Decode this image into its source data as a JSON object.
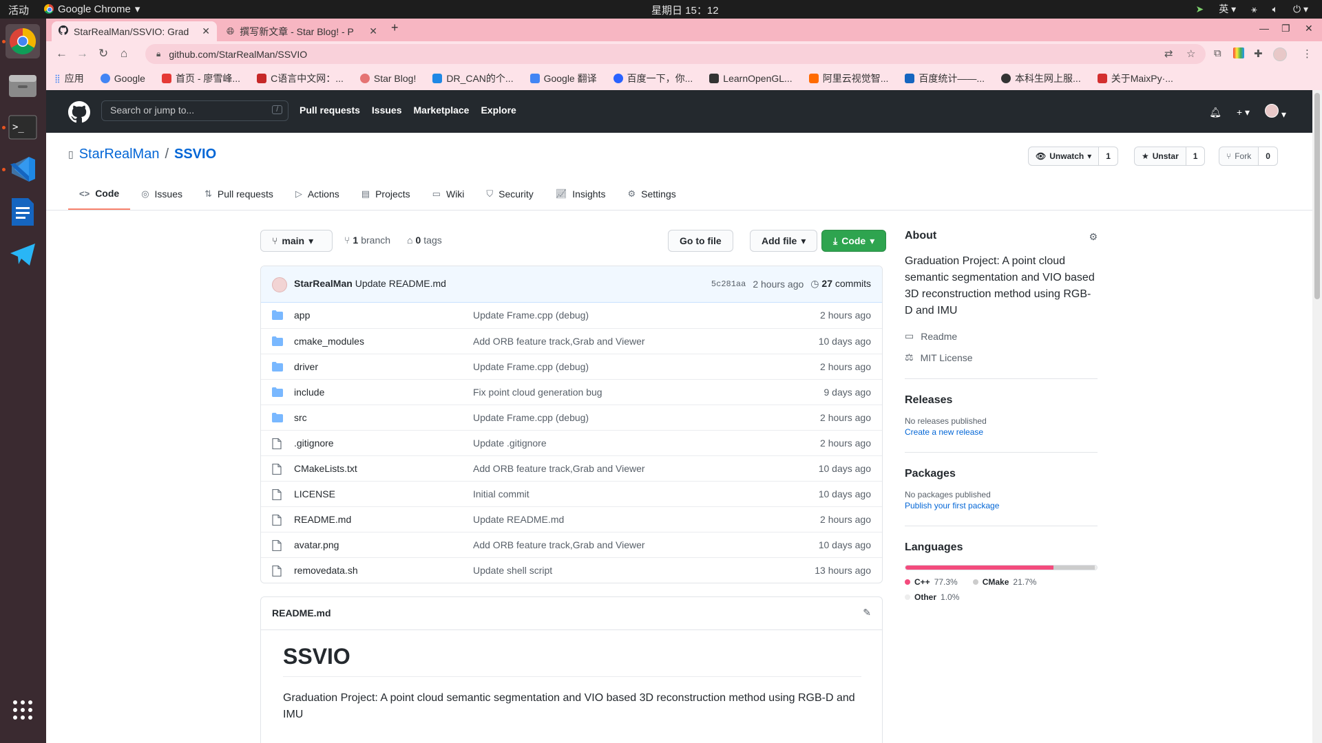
{
  "os": {
    "activities": "活动",
    "app_name": "Google Chrome",
    "clock": "星期日 15：12",
    "ime": "英"
  },
  "browser": {
    "tabs": [
      {
        "title": "StarRealMan/SSVIO: Grad",
        "active": true
      },
      {
        "title": "撰写新文章 - Star Blog! - P",
        "active": false
      }
    ],
    "url": "github.com/StarRealMan/SSVIO",
    "bookmarks": [
      {
        "label": "应用",
        "color": "#4285f4"
      },
      {
        "label": "Google",
        "color": "#4285f4"
      },
      {
        "label": "首页 - 廖雪峰...",
        "color": "#e53935"
      },
      {
        "label": "C语言中文网：...",
        "color": "#c62828"
      },
      {
        "label": "Star Blog!",
        "color": "#e57373"
      },
      {
        "label": "DR_CAN的个...",
        "color": "#1e88e5"
      },
      {
        "label": "Google 翻译",
        "color": "#4285f4"
      },
      {
        "label": "百度一下，你...",
        "color": "#2962ff"
      },
      {
        "label": "LearnOpenGL...",
        "color": "#333333"
      },
      {
        "label": "阿里云视觉智...",
        "color": "#ff6a00"
      },
      {
        "label": "百度统计——...",
        "color": "#1565c0"
      },
      {
        "label": "本科生网上服...",
        "color": "#333333"
      },
      {
        "label": "关于MaixPy·...",
        "color": "#d32f2f"
      }
    ]
  },
  "github": {
    "search_placeholder": "Search or jump to...",
    "search_key": "/",
    "nav": [
      "Pull requests",
      "Issues",
      "Marketplace",
      "Explore"
    ]
  },
  "repo": {
    "owner": "StarRealMan",
    "slash": "/",
    "name": "SSVIO",
    "watch_label": "Unwatch",
    "watch_count": "1",
    "star_label": "Unstar",
    "star_count": "1",
    "fork_label": "Fork",
    "fork_count": "0",
    "tabs": [
      "Code",
      "Issues",
      "Pull requests",
      "Actions",
      "Projects",
      "Wiki",
      "Security",
      "Insights",
      "Settings"
    ],
    "branch": "main",
    "branch_count": "1",
    "branch_word": "branch",
    "tag_count": "0",
    "tag_word": "tags",
    "go_to_file": "Go to file",
    "add_file": "Add file",
    "code_button": "Code",
    "commit": {
      "author": "StarRealMan",
      "message": "Update README.md",
      "sha": "5c281aa",
      "age": "2 hours ago",
      "count": "27",
      "count_word": "commits"
    },
    "files": [
      {
        "type": "dir",
        "name": "app",
        "message": "Update Frame.cpp (debug)",
        "age": "2 hours ago"
      },
      {
        "type": "dir",
        "name": "cmake_modules",
        "message": "Add ORB feature track,Grab and Viewer",
        "age": "10 days ago"
      },
      {
        "type": "dir",
        "name": "driver",
        "message": "Update Frame.cpp (debug)",
        "age": "2 hours ago"
      },
      {
        "type": "dir",
        "name": "include",
        "message": "Fix point cloud generation bug",
        "age": "9 days ago"
      },
      {
        "type": "dir",
        "name": "src",
        "message": "Update Frame.cpp (debug)",
        "age": "2 hours ago"
      },
      {
        "type": "file",
        "name": ".gitignore",
        "message": "Update .gitignore",
        "age": "2 hours ago"
      },
      {
        "type": "file",
        "name": "CMakeLists.txt",
        "message": "Add ORB feature track,Grab and Viewer",
        "age": "10 days ago"
      },
      {
        "type": "file",
        "name": "LICENSE",
        "message": "Initial commit",
        "age": "10 days ago"
      },
      {
        "type": "file",
        "name": "README.md",
        "message": "Update README.md",
        "age": "2 hours ago"
      },
      {
        "type": "file",
        "name": "avatar.png",
        "message": "Add ORB feature track,Grab and Viewer",
        "age": "10 days ago"
      },
      {
        "type": "file",
        "name": "removedata.sh",
        "message": "Update shell script",
        "age": "13 hours ago"
      }
    ],
    "readme": {
      "filename": "README.md",
      "heading": "SSVIO",
      "text": "Graduation Project: A point cloud semantic segmentation and VIO based 3D reconstruction method using RGB-D and IMU"
    },
    "about": {
      "title": "About",
      "description": "Graduation Project: A point cloud semantic segmentation and VIO based 3D reconstruction method using RGB-D and IMU",
      "readme_link": "Readme",
      "license_link": "MIT License"
    },
    "releases": {
      "title": "Releases",
      "empty": "No releases published",
      "action": "Create a new release"
    },
    "packages": {
      "title": "Packages",
      "empty": "No packages published",
      "action": "Publish your first package"
    },
    "languages": {
      "title": "Languages",
      "items": [
        {
          "name": "C++",
          "percent": "77.3%",
          "value": 77.3,
          "color": "#f34b7d"
        },
        {
          "name": "CMake",
          "percent": "21.7%",
          "value": 21.7,
          "color": "#cccccc"
        },
        {
          "name": "Other",
          "percent": "1.0%",
          "value": 1.0,
          "color": "#ededed"
        }
      ]
    }
  }
}
